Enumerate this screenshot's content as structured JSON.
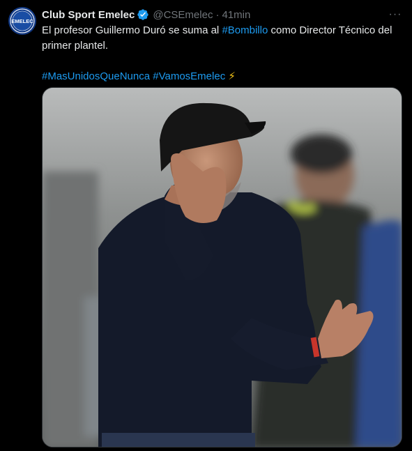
{
  "tweet": {
    "author_name": "Club Sport Emelec",
    "handle": "@CSEmelec",
    "separator": "·",
    "time": "41min",
    "more_label": "···",
    "avatar_text": "EMELEC",
    "text_line1_prefix": "El profesor Guillermo Duró se suma al ",
    "text_hashtag1": "#Bombillo",
    "text_line1_suffix": " como Director Técnico del primer plantel.",
    "hashtag2": "#MasUnidosQueNunca",
    "hashtag3": "#VamosEmelec",
    "emoji": "⚡",
    "media_alt": "Photo of coach in black cap and navy sweater gesturing on the field",
    "icons": {
      "verified": "verified-badge-icon",
      "more": "more-options-icon",
      "bolt": "lightning-emoji-icon"
    },
    "colors": {
      "background": "#000000",
      "text": "#e7e9ea",
      "secondary": "#71767b",
      "link": "#1d9bf0",
      "avatar": "#123a86"
    }
  }
}
